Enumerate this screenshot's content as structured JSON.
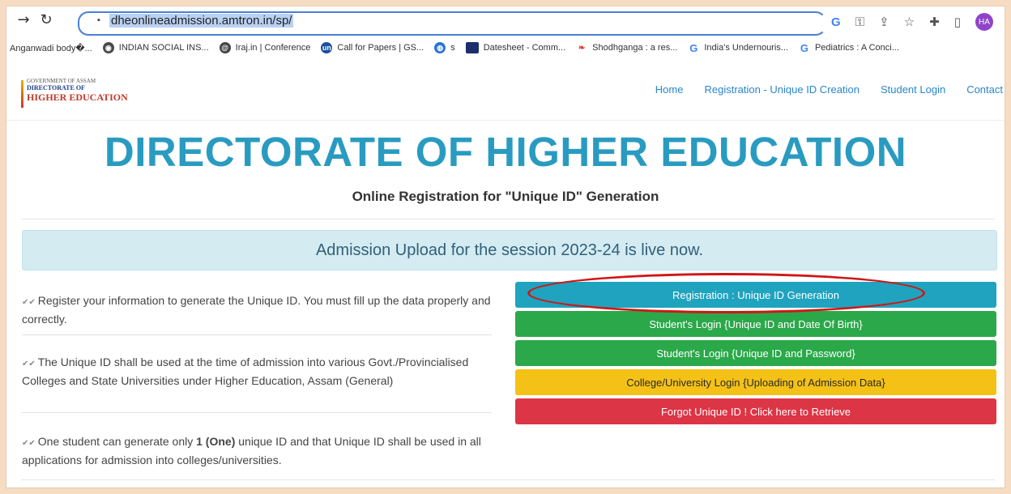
{
  "browser": {
    "url": "dheonlineadmission.amtron.in/sp/",
    "avatar": "HA",
    "bookmarks": [
      {
        "label": "Anganwadi body�...",
        "icon": "none"
      },
      {
        "label": "INDIAN SOCIAL INS...",
        "icon": "globe-icon"
      },
      {
        "label": "Iraj.in | Conference",
        "icon": "iraj-icon"
      },
      {
        "label": "Call for Papers | GS...",
        "icon": "gs-icon"
      },
      {
        "label": "s",
        "icon": "s-icon"
      },
      {
        "label": "Datesheet - Comm...",
        "icon": "datesheet-icon"
      },
      {
        "label": "Shodhganga : a res...",
        "icon": "shodhganga-icon"
      },
      {
        "label": "India's Undernouris...",
        "icon": "google-icon"
      },
      {
        "label": "Pediatrics : A Conci...",
        "icon": "google-icon"
      }
    ]
  },
  "site": {
    "logo": {
      "line1": "GOVERNMENT OF ASSAM",
      "line2": "DIRECTORATE OF",
      "line3": "HIGHER EDUCATION"
    },
    "nav": [
      "Home",
      "Registration - Unique ID Creation",
      "Student Login",
      "Contact"
    ],
    "title": "DIRECTORATE OF HIGHER EDUCATION",
    "subtitle": "Online Registration for \"Unique ID\" Generation",
    "alert": "Admission Upload for the session 2023-24 is live now.",
    "info": {
      "p1": "Register your information to generate the Unique ID. You must fill up the data properly and correctly.",
      "p2": "The Unique ID shall be used at the time of admission into various Govt./Provincialised Colleges and State Universities under Higher Education, Assam (General)",
      "p3_prefix": "One student can generate only ",
      "p3_bold": "1 (One)",
      "p3_suffix": " unique ID and that Unique ID shall be used in all applications for admission into colleges/universities."
    },
    "buttons": [
      {
        "label": "Registration : Unique ID Generation",
        "color": "#1fa3be"
      },
      {
        "label": "Student's Login {Unique ID and Date Of Birth}",
        "color": "#2ba84a"
      },
      {
        "label": "Student's Login {Unique ID and Password}",
        "color": "#2ba84a"
      },
      {
        "label": "College/University Login {Uploading of Admission Data}",
        "color": "#f4c116"
      },
      {
        "label": "Forgot Unique ID ! Click here to Retrieve",
        "color": "#dc3545"
      }
    ]
  }
}
